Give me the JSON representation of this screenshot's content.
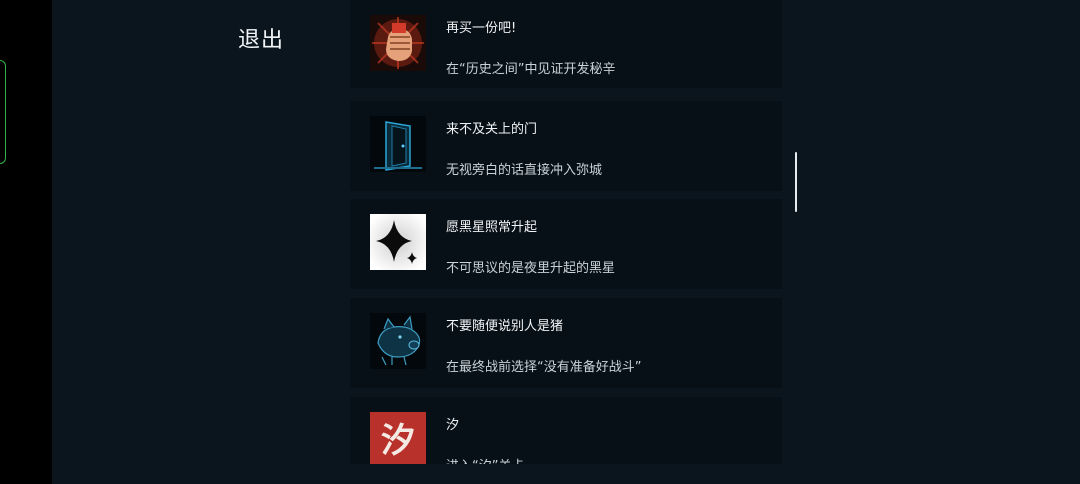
{
  "exit_label": "退出",
  "achievements": [
    {
      "title": "再买一份吧!",
      "desc": "在“历史之间”中见证开发秘辛",
      "icon": "fist-icon"
    },
    {
      "title": "来不及关上的门",
      "desc": "无视旁白的话直接冲入弥城",
      "icon": "door-icon"
    },
    {
      "title": "愿黑星照常升起",
      "desc": "不可思议的是夜里升起的黑星",
      "icon": "black-star-icon"
    },
    {
      "title": "不要随便说别人是猪",
      "desc": "在最终战前选择“没有准备好战斗”",
      "icon": "pig-icon"
    },
    {
      "title": "汐",
      "desc": "进入“汐”关卡",
      "icon": "xi-character-icon",
      "icon_text": "汐"
    }
  ],
  "colors": {
    "background": "#0a151d",
    "card": "#081017",
    "side_handle": "#2fb24a"
  }
}
